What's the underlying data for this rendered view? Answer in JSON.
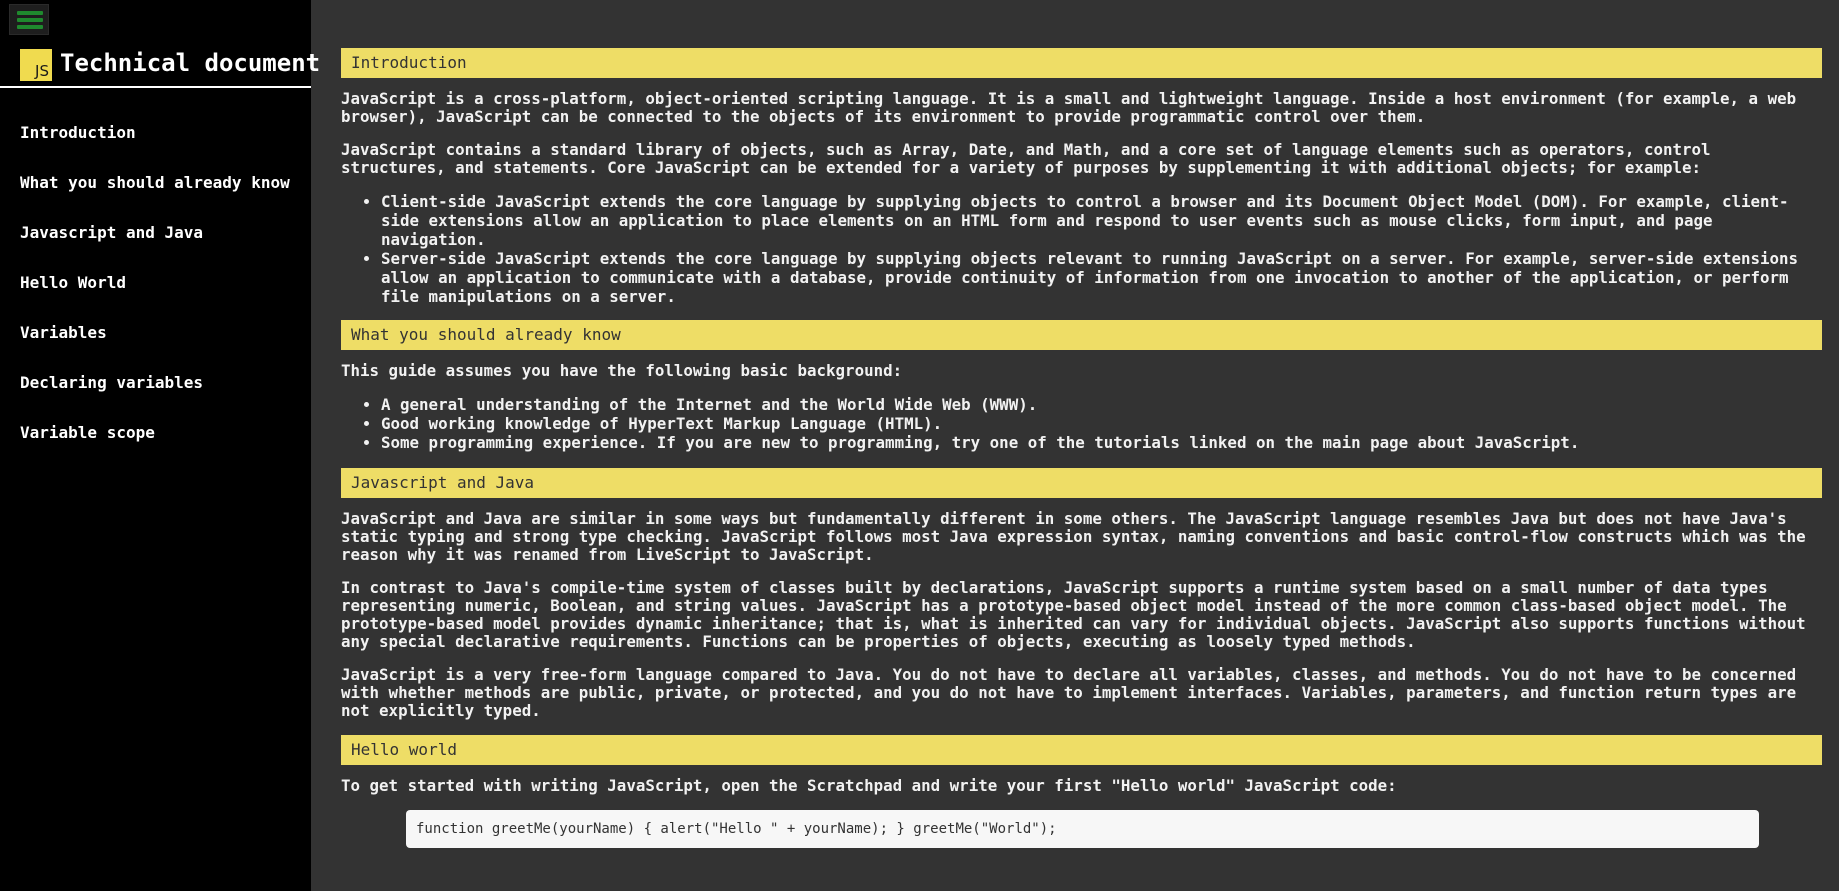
{
  "sidebar": {
    "menu_icon": "hamburger-menu-icon",
    "logo_text": "JS",
    "title": "Technical document",
    "nav": [
      {
        "label": "Introduction"
      },
      {
        "label": "What you should already know"
      },
      {
        "label": "Javascript and Java"
      },
      {
        "label": "Hello World"
      },
      {
        "label": "Variables"
      },
      {
        "label": "Declaring variables"
      },
      {
        "label": "Variable scope"
      }
    ]
  },
  "sections": {
    "introduction": {
      "header": "Introduction",
      "p1": "JavaScript is a cross-platform, object-oriented scripting language. It is a small and lightweight language. Inside a host environment (for example, a web browser), JavaScript can be connected to the objects of its environment to provide programmatic control over them.",
      "p2": "JavaScript contains a standard library of objects, such as Array, Date, and Math, and a core set of language elements such as operators, control structures, and statements. Core JavaScript can be extended for a variety of purposes by supplementing it with additional objects; for example:",
      "items": [
        "Client-side JavaScript extends the core language by supplying objects to control a browser and its Document Object Model (DOM). For example, client-side extensions allow an application to place elements on an HTML form and respond to user events such as mouse clicks, form input, and page navigation.",
        "Server-side JavaScript extends the core language by supplying objects relevant to running JavaScript on a server. For example, server-side extensions allow an application to communicate with a database, provide continuity of information from one invocation to another of the application, or perform file manipulations on a server."
      ]
    },
    "knowledge": {
      "header": "What you should already know",
      "p1": "This guide assumes you have the following basic background:",
      "items": [
        "A general understanding of the Internet and the World Wide Web (WWW).",
        "Good working knowledge of HyperText Markup Language (HTML).",
        "Some programming experience. If you are new to programming, try one of the tutorials linked on the main page about JavaScript."
      ]
    },
    "java": {
      "header": "Javascript and Java",
      "p1": "JavaScript and Java are similar in some ways but fundamentally different in some others. The JavaScript language resembles Java but does not have Java's static typing and strong type checking. JavaScript follows most Java expression syntax, naming conventions and basic control-flow constructs which was the reason why it was renamed from LiveScript to JavaScript.",
      "p2": "In contrast to Java's compile-time system of classes built by declarations, JavaScript supports a runtime system based on a small number of data types representing numeric, Boolean, and string values. JavaScript has a prototype-based object model instead of the more common class-based object model. The prototype-based model provides dynamic inheritance; that is, what is inherited can vary for individual objects. JavaScript also supports functions without any special declarative requirements. Functions can be properties of objects, executing as loosely typed methods.",
      "p3": "JavaScript is a very free-form language compared to Java. You do not have to declare all variables, classes, and methods. You do not have to be concerned with whether methods are public, private, or protected, and you do not have to implement interfaces. Variables, parameters, and function return types are not explicitly typed."
    },
    "hello": {
      "header": "Hello world",
      "p1": "To get started with writing JavaScript, open the Scratchpad and write your first \"Hello world\" JavaScript code:",
      "code": "function greetMe(yourName) { alert(\"Hello \" + yourName); } greetMe(\"World\");"
    }
  },
  "colors": {
    "sidebar_bg": "#000000",
    "main_bg": "#333333",
    "header_bg": "#eedd66",
    "logo_bg": "#f0db4f",
    "menu_icon": "#1f8a2e"
  }
}
